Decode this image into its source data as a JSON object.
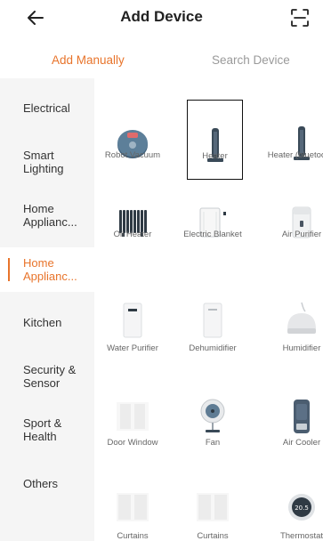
{
  "header": {
    "title": "Add Device"
  },
  "tabs": {
    "manual": "Add Manually",
    "search": "Search Device"
  },
  "sidebar": {
    "items": [
      {
        "label": "Electrical"
      },
      {
        "label": "Smart Lighting"
      },
      {
        "label": "Home Applianc..."
      },
      {
        "label": "Home Applianc...",
        "active": true
      },
      {
        "label": "Kitchen"
      },
      {
        "label": "Security & Sensor"
      },
      {
        "label": "Sport & Health"
      },
      {
        "label": "Others"
      }
    ]
  },
  "devices": [
    {
      "label": "Robot Vacuum",
      "icon": "robot-vacuum-icon"
    },
    {
      "label": "Heater",
      "icon": "heater-icon",
      "selected": true
    },
    {
      "label": "Heater (bluetooth)",
      "icon": "heater-icon"
    },
    {
      "label": "Oil Heater",
      "icon": "oil-heater-icon"
    },
    {
      "label": "Electric Blanket",
      "icon": "electric-blanket-icon"
    },
    {
      "label": "Air Purifier",
      "icon": "air-purifier-icon"
    },
    {
      "label": "Water Purifier",
      "icon": "water-purifier-icon"
    },
    {
      "label": "Dehumidifier",
      "icon": "dehumidifier-icon"
    },
    {
      "label": "Humidifier",
      "icon": "humidifier-icon"
    },
    {
      "label": "Door Window",
      "icon": "door-window-icon"
    },
    {
      "label": "Fan",
      "icon": "fan-icon"
    },
    {
      "label": "Air Cooler",
      "icon": "air-cooler-icon"
    },
    {
      "label": "Curtains",
      "icon": "curtains-icon"
    },
    {
      "label": "Curtains",
      "icon": "curtains-icon"
    },
    {
      "label": "Thermostat",
      "icon": "thermostat-icon"
    }
  ],
  "thermostat_reading": "20.5",
  "colors": {
    "accent": "#e8742b",
    "sidebar_bg": "#f5f5f5"
  }
}
